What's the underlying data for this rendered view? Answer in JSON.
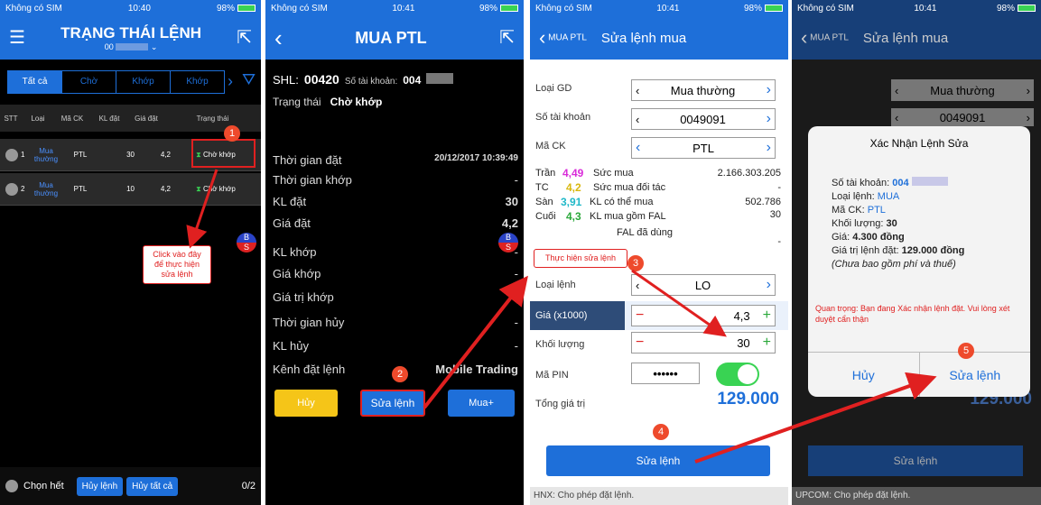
{
  "p1": {
    "status": {
      "carrier": "Không có SIM",
      "time": "10:40",
      "battery": "98%"
    },
    "title": "TRẠNG THÁI LỆNH",
    "subtitle": "00",
    "tabs": [
      "Tất cả",
      "Chờ",
      "Khớp",
      "Khớp"
    ],
    "columns": [
      "STT",
      "Loại",
      "Mã CK",
      "KL đặt",
      "Giá đặt",
      "Trạng thái"
    ],
    "rows": [
      {
        "stt": "1",
        "loai": "Mua thường",
        "mack": "PTL",
        "kl": "30",
        "gia": "4,2",
        "trangthai": "Chờ khớp"
      },
      {
        "stt": "2",
        "loai": "Mua thường",
        "mack": "PTL",
        "kl": "10",
        "gia": "4,2",
        "trangthai": "Chờ khớp"
      }
    ],
    "callout": "Click vào đây để thực hiện sửa lệnh",
    "step": "1",
    "footer": {
      "select_all": "Chọn hết",
      "cancel_order": "Hủy lệnh",
      "cancel_all": "Hủy tất cả",
      "count": "0/2"
    }
  },
  "p2": {
    "status": {
      "carrier": "Không có SIM",
      "time": "10:41",
      "battery": "98%"
    },
    "title": "MUA  PTL",
    "shl_label": "SHL:",
    "shl_value": "00420",
    "account_label": "Số tài khoản:",
    "account_value": "004",
    "status_label": "Trạng thái",
    "status_value": "Chờ khớp",
    "fields": [
      {
        "label": "Thời gian đặt",
        "value": "20/12/2017 10:39:49"
      },
      {
        "label": "Thời gian khớp",
        "value": "-"
      },
      {
        "label": "KL đặt",
        "value": "30"
      },
      {
        "label": "Giá đặt",
        "value": "4,2"
      },
      {
        "label": "KL khớp",
        "value": "-"
      },
      {
        "label": "Giá khớp",
        "value": "-"
      },
      {
        "label": "Giá trị khớp",
        "value": "-"
      },
      {
        "label": "Thời gian hủy",
        "value": "-"
      },
      {
        "label": "KL hủy",
        "value": "-"
      },
      {
        "label": "Kênh đặt lệnh",
        "value": "Mobile Trading"
      }
    ],
    "buttons": {
      "cancel": "Hủy",
      "edit": "Sửa lệnh",
      "buy_more": "Mua+"
    },
    "step": "2"
  },
  "p3": {
    "status": {
      "carrier": "Không có SIM",
      "time": "10:41",
      "battery": "98%"
    },
    "back": "MUA  PTL",
    "title": "Sửa lệnh mua",
    "loai_gd_label": "Loại GD",
    "loai_gd": "Mua thường",
    "account_label": "Số tài khoản",
    "account": "0049091",
    "mack_label": "Mã CK",
    "mack": "PTL",
    "prices": [
      {
        "label": "Trần",
        "value": "4,49",
        "color": "#d92bd9"
      },
      {
        "label": "TC",
        "value": "4,2",
        "color": "#d9b80f"
      },
      {
        "label": "Sàn",
        "value": "3,91",
        "color": "#1fb8c8"
      },
      {
        "label": "Cuối",
        "value": "4,3",
        "color": "#2aa83a"
      }
    ],
    "stats": [
      {
        "label": "Sức mua",
        "value": "2.166.303.205"
      },
      {
        "label": "Sức mua đối tác",
        "value": "-"
      },
      {
        "label": "KL có thể mua",
        "value": "502.786"
      },
      {
        "label": "KL mua gồm FAL",
        "value": "30"
      },
      {
        "label": "FAL đã dùng",
        "value": "-"
      }
    ],
    "callout": "Thực hiện sửa lệnh",
    "order_type_label": "Loại lệnh",
    "order_type": "LO",
    "price_label": "Giá (x1000)",
    "price": "4,3",
    "qty_label": "Khối lượng",
    "qty": "30",
    "pin_label": "Mã PIN",
    "pin": "••••••",
    "total_label": "Tổng giá trị",
    "total": "129.000",
    "submit": "Sửa lệnh",
    "footer": "HNX: Cho phép đặt lệnh.",
    "steps": [
      "3",
      "4"
    ]
  },
  "p4": {
    "status": {
      "carrier": "Không có SIM",
      "time": "10:41",
      "battery": "98%"
    },
    "back": "MUA  PTL",
    "title": "Sửa lệnh mua",
    "bg_loai_gd": "Mua thường",
    "bg_account": "0049091",
    "bg_total": "129.000",
    "bg_submit": "Sửa lệnh",
    "dialog": {
      "title": "Xác Nhận Lệnh Sửa",
      "account_label": "Số tài khoản:",
      "account": "004",
      "type_label": "Loại lệnh:",
      "type": "MUA",
      "code_label": "Mã CK:",
      "code": "PTL",
      "qty_label": "Khối lượng:",
      "qty": "30",
      "price_label": "Giá:",
      "price": "4.300 đồng",
      "value_label": "Giá trị lệnh đặt:",
      "value": "129.000 đồng",
      "note": "(Chưa bao gồm phí và thuế)",
      "warning": "Quan trọng: Bạn đang Xác nhận lệnh đặt. Vui lòng xét duyệt cẩn thận",
      "cancel": "Hủy",
      "confirm": "Sửa lệnh"
    },
    "footer": "UPCOM: Cho phép đặt lệnh.",
    "step": "5"
  }
}
